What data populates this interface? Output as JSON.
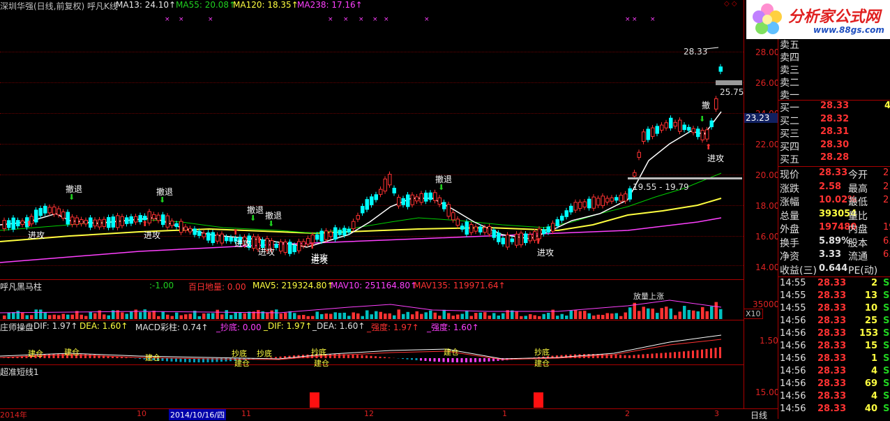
{
  "main_header": {
    "title": "深圳华强(日线,前复权) 呼凡K线",
    "ma13": "MA13: 24.10↑",
    "ma55": "MA55: 20.08↑",
    "ma120": "MA120: 18.35↑",
    "ma238": "MA238: 17.16↑"
  },
  "price_axis": [
    "28.00",
    "26.00",
    "24.00",
    "22.00",
    "20.00",
    "18.00",
    "16.00",
    "14.00"
  ],
  "price_current": "23.23",
  "annotations": {
    "high": "28.33",
    "mid": "25.75",
    "range": "19.55 - 19.79",
    "attack": "进攻",
    "retreat": "撤退",
    "retreat_short": "撤",
    "attack_mid": "进攻"
  },
  "vol_header": {
    "title": "呼凡黑马柱",
    "v1": ":-1.00",
    "v2": "百日地量: 0.00",
    "mav5": "MAV5: 219324.80↑",
    "mav10": "MAV10: 251164.80↑",
    "mav135": "MAV135: 119971.64↑"
  },
  "vol_axis": "35000",
  "vol_unit": "X10",
  "vol_label": "放量上涨",
  "macd_header": {
    "title": "庄师操盘",
    "dif": "DIF: 1.97↑",
    "dea": "DEA: 1.60↑",
    "macd": "MACD彩柱: 0.74↑",
    "chaodi": "_抄底: 0.00",
    "dif2": "_DIF: 1.97↑",
    "dea2": "_DEA: 1.60↑",
    "qd1": "_强度: 1.97↑",
    "qd2": "_强度: 1.60↑"
  },
  "macd_axis": "1.50",
  "macd_labels": {
    "jiancang": "建仓",
    "chaodi": "抄底",
    "jianchang": "建仓"
  },
  "short_header": "超准短线1",
  "short_axis": "15.00",
  "time_axis": [
    "2014年",
    "10",
    "2014/10/16/四",
    "11",
    "12",
    "1",
    "2",
    "3"
  ],
  "period": "日线",
  "logo": {
    "text": "分析家公式网",
    "url": "www.88gs.com"
  },
  "order_book": {
    "sells": [
      {
        "label": "卖五"
      },
      {
        "label": "卖四"
      },
      {
        "label": "卖三"
      },
      {
        "label": "卖二"
      },
      {
        "label": "卖一"
      }
    ],
    "buys": [
      {
        "label": "买一",
        "price": "28.33",
        "vol": "4"
      },
      {
        "label": "买二",
        "price": "28.32",
        "vol": ""
      },
      {
        "label": "买三",
        "price": "28.31",
        "vol": ""
      },
      {
        "label": "买四",
        "price": "28.30",
        "vol": ""
      },
      {
        "label": "买五",
        "price": "28.28",
        "vol": ""
      }
    ]
  },
  "quote": [
    {
      "l": "现价",
      "v": "28.33",
      "l2": "今开",
      "v2": "2"
    },
    {
      "l": "涨跌",
      "v": "2.58",
      "l2": "最高",
      "v2": "2"
    },
    {
      "l": "涨幅",
      "v": "10.02%",
      "l2": "最低",
      "v2": "2"
    },
    {
      "l": "总量",
      "v": "393054",
      "l2": "量比",
      "v2": ""
    },
    {
      "l": "外盘",
      "v": "197480",
      "l2": "内盘",
      "v2": "19"
    },
    {
      "l": "换手",
      "v": "5.89%",
      "l2": "股本",
      "v2": "6."
    },
    {
      "l": "净资",
      "v": "3.33",
      "l2": "流通",
      "v2": "6."
    },
    {
      "l": "收益(三)",
      "v": "0.644",
      "l2": "PE(动)",
      "v2": ""
    }
  ],
  "ticks": [
    {
      "t": "14:55",
      "p": "28.33",
      "n": "2",
      "s": "S"
    },
    {
      "t": "14:55",
      "p": "28.33",
      "n": "13",
      "s": "S"
    },
    {
      "t": "14:55",
      "p": "28.33",
      "n": "10",
      "s": "S"
    },
    {
      "t": "14:56",
      "p": "28.33",
      "n": "25",
      "s": "S"
    },
    {
      "t": "14:56",
      "p": "28.33",
      "n": "153",
      "s": "S"
    },
    {
      "t": "14:56",
      "p": "28.33",
      "n": "15",
      "s": "S"
    },
    {
      "t": "14:56",
      "p": "28.33",
      "n": "1",
      "s": "S"
    },
    {
      "t": "14:56",
      "p": "28.33",
      "n": "4",
      "s": "S"
    },
    {
      "t": "14:56",
      "p": "28.33",
      "n": "69",
      "s": "S"
    },
    {
      "t": "14:56",
      "p": "28.33",
      "n": "4",
      "s": "S"
    },
    {
      "t": "14:56",
      "p": "28.33",
      "n": "40",
      "s": "S"
    }
  ],
  "colors": {
    "up": "#ff3232",
    "down": "#00ffff",
    "ma13": "#ffffff",
    "ma55": "#00d000",
    "ma120": "#ffff40",
    "ma238": "#ff40ff",
    "grid": "#7a0000"
  }
}
